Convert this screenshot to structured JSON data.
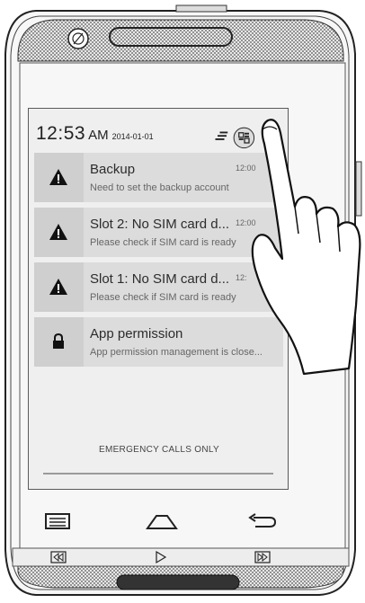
{
  "status": {
    "time": "12:53",
    "ampm": "AM",
    "date": "2014-01-01"
  },
  "notifications": [
    {
      "icon": "warning-icon",
      "title": "Backup",
      "subtitle": "Need to set the backup account",
      "time": "12:00"
    },
    {
      "icon": "warning-icon",
      "title": "Slot 2: No SIM card d...",
      "subtitle": "Please check if SIM card is ready",
      "time": "12:00"
    },
    {
      "icon": "warning-icon",
      "title": "Slot 1: No SIM card d...",
      "subtitle": "Please check if SIM card is ready",
      "time": "12:"
    },
    {
      "icon": "lock-icon",
      "title": "App permission",
      "subtitle": "App permission management is close...",
      "time": ""
    }
  ],
  "emergency_text": "EMERGENCY CALLS ONLY",
  "colors": {
    "screen": "#efefef",
    "card": "#dcdcdc",
    "icon_cell": "#cfcfcf",
    "text": "#2c2c2c"
  }
}
